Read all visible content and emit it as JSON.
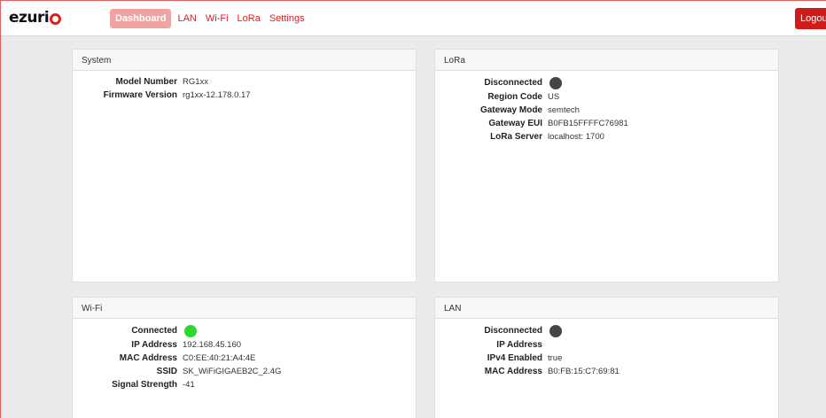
{
  "brand": {
    "logo_text": "ezurio"
  },
  "nav": {
    "items": [
      {
        "label": "Dashboard",
        "active": true
      },
      {
        "label": "LAN",
        "active": false
      },
      {
        "label": "Wi-Fi",
        "active": false
      },
      {
        "label": "LoRa",
        "active": false
      },
      {
        "label": "Settings",
        "active": false
      }
    ],
    "logout_label": "Logout"
  },
  "colors": {
    "accent": "#dc2020",
    "active_tab": "#f0a3a3",
    "connected": "#2ed72e",
    "disconnected": "#454545"
  },
  "system": {
    "title": "System",
    "rows": [
      {
        "label": "Model Number",
        "value": "RG1xx"
      },
      {
        "label": "Firmware Version",
        "value": "rg1xx-12.178.0.17"
      }
    ]
  },
  "lora": {
    "title": "LoRa",
    "status_label": "Disconnected",
    "status_icon": "status-dot-gray",
    "rows": [
      {
        "label": "Region Code",
        "value": "US"
      },
      {
        "label": "Gateway Mode",
        "value": "semtech"
      },
      {
        "label": "Gateway EUI",
        "value": "B0FB15FFFFC76981"
      },
      {
        "label": "LoRa Server",
        "value": "localhost: 1700"
      }
    ]
  },
  "wifi": {
    "title": "Wi-Fi",
    "status_label": "Connected",
    "status_icon": "status-dot-green",
    "rows": [
      {
        "label": "IP Address",
        "value": "192.168.45.160"
      },
      {
        "label": "MAC Address",
        "value": "C0:EE:40:21:A4:4E"
      },
      {
        "label": "SSID",
        "value": "SK_WiFiGIGAEB2C_2.4G"
      },
      {
        "label": "Signal Strength",
        "value": "-41"
      }
    ]
  },
  "lan": {
    "title": "LAN",
    "status_label": "Disconnected",
    "status_icon": "status-dot-gray",
    "rows": [
      {
        "label": "IP Address",
        "value": ""
      },
      {
        "label": "IPv4 Enabled",
        "value": "true"
      },
      {
        "label": "MAC Address",
        "value": "B0:FB:15:C7:69:81"
      }
    ]
  }
}
